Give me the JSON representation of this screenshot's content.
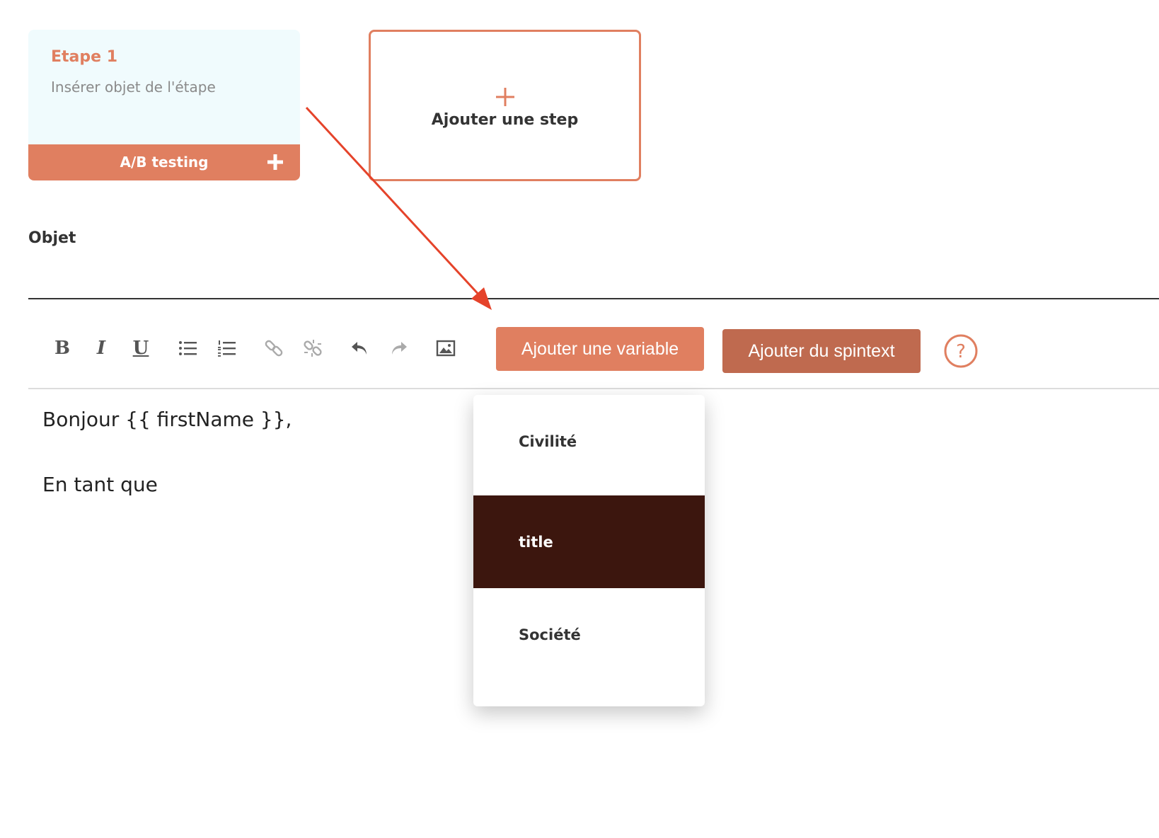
{
  "step_card": {
    "title": "Etape 1",
    "subject": "Insérer objet de l'étape",
    "ab_testing_label": "A/B testing"
  },
  "add_step": {
    "label": "Ajouter une step"
  },
  "objet": {
    "label": "Objet"
  },
  "toolbar": {
    "bold": "B",
    "italic": "I",
    "underline": "U",
    "add_variable": "Ajouter une variable",
    "add_spintext": "Ajouter du spintext"
  },
  "editor": {
    "lines": [
      "Bonjour {{ firstName }},",
      "En tant que"
    ]
  },
  "dropdown": {
    "items": [
      "Civilité",
      "title",
      "Société"
    ],
    "selected": "title"
  },
  "colors": {
    "accent": "#e07f60",
    "accent_dark": "#bf6a4f",
    "selected_item": "#3c160e",
    "card_background": "#f0fbfd",
    "annotation_arrow": "#e5432a"
  }
}
